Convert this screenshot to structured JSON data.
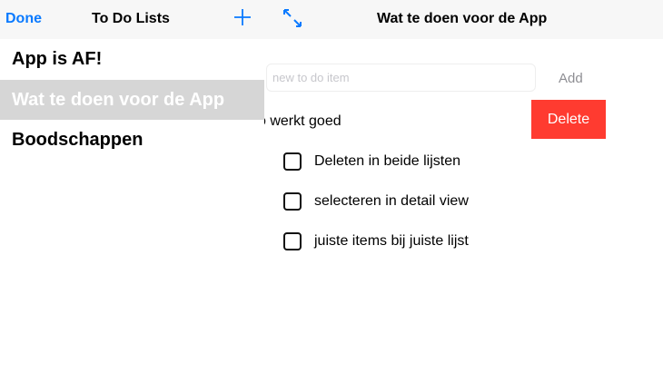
{
  "nav": {
    "done": "Done",
    "sidebar_title": "To Do Lists",
    "detail_title": "Wat te doen voor de App",
    "add_icon": "plus-icon",
    "expand_icon": "expand-arrows-icon"
  },
  "sidebar": {
    "items": [
      {
        "label": "App is AF!"
      },
      {
        "label": "Wat te doen voor de App",
        "selected": true
      },
      {
        "label": "Boodschappen"
      }
    ]
  },
  "detail": {
    "new_item_placeholder": "new to do item",
    "add_label": "Add",
    "swiped_item": "o werkt goed",
    "delete_label": "Delete",
    "items": [
      {
        "label": "Deleten in beide lijsten",
        "checked": false
      },
      {
        "label": "selecteren in detail view",
        "checked": false
      },
      {
        "label": "juiste items bij juiste lijst",
        "checked": false
      }
    ]
  },
  "colors": {
    "accent": "#0a7aff",
    "delete": "#ff3b30",
    "selected_row": "#d6d6d6"
  }
}
